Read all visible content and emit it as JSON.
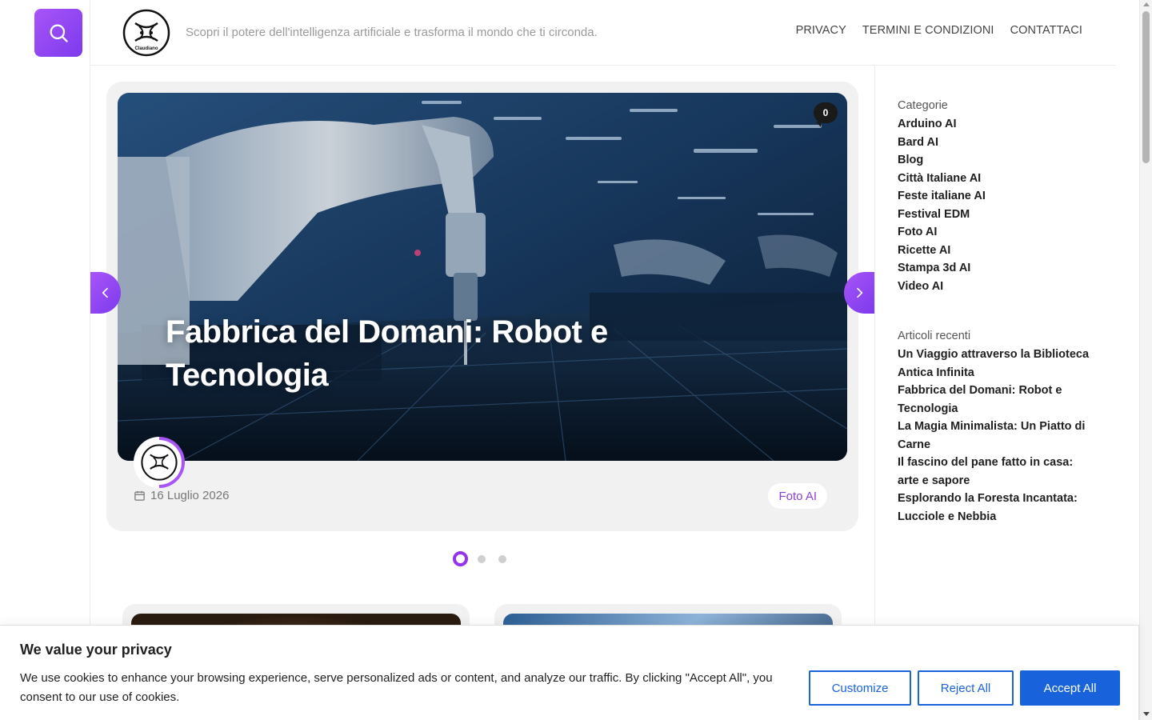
{
  "header": {
    "tagline": "Scopri il potere dell'intelligenza artificiale e trasforma il mondo che ti circonda.",
    "logo_text": "Claudiano",
    "nav": [
      "PRIVACY",
      "TERMINI E CONDIZIONI",
      "CONTATTACI"
    ]
  },
  "slider": {
    "title": "Fabbrica del Domani: Robot e Tecnologia",
    "comment_count": "0",
    "date": "16 Luglio 2026",
    "category": "Foto AI",
    "active_slide": 1,
    "slide_count": 3
  },
  "sidebar": {
    "categories_title": "Categorie",
    "categories": [
      "Arduino AI",
      "Bard AI",
      "Blog",
      "Città Italiane AI",
      "Feste italiane AI",
      "Festival EDM",
      "Foto AI",
      "Ricette AI",
      "Stampa 3d AI",
      "Video AI"
    ],
    "recent_title": "Articoli recenti",
    "recent": [
      "Un Viaggio attraverso la Biblioteca Antica Infinita",
      "Fabbrica del Domani: Robot e Tecnologia",
      "La Magia Minimalista: Un Piatto di Carne",
      "Il fascino del pane fatto in casa: arte e sapore",
      "Esplorando la Foresta Incantata: Lucciole e Nebbia"
    ]
  },
  "cookie": {
    "title": "We value your privacy",
    "text": "We use cookies to enhance your browsing experience, serve personalized ads or content, and analyze our traffic. By clicking \"Accept All\", you consent to our use of cookies.",
    "customize": "Customize",
    "reject": "Reject All",
    "accept": "Accept All"
  },
  "colors": {
    "accent_purple": "#9333ea",
    "accent_purple_light": "#a855f7",
    "cookie_blue": "#1863dc"
  }
}
